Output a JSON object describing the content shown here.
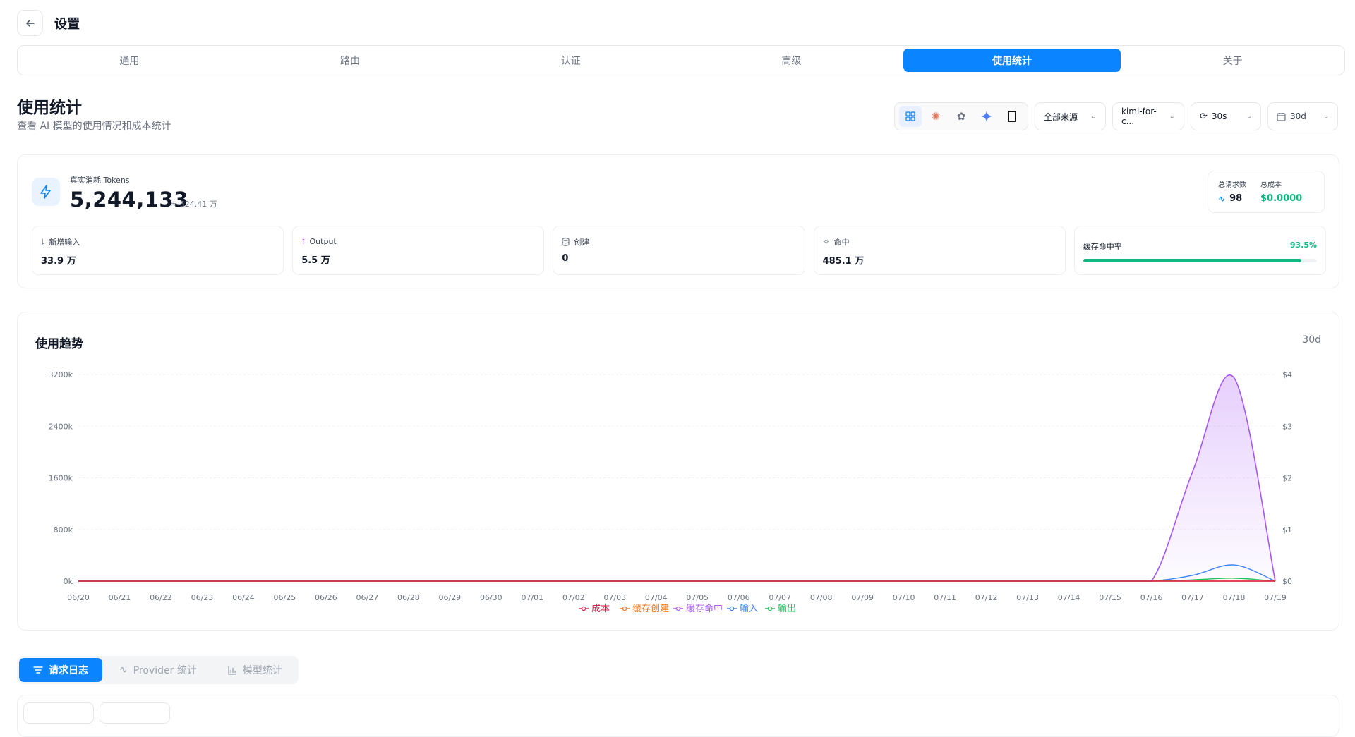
{
  "header": {
    "title": "设置"
  },
  "tabs": [
    {
      "label": "通用",
      "active": false
    },
    {
      "label": "路由",
      "active": false
    },
    {
      "label": "认证",
      "active": false
    },
    {
      "label": "高级",
      "active": false
    },
    {
      "label": "使用统计",
      "active": true
    },
    {
      "label": "关于",
      "active": false
    }
  ],
  "section": {
    "title": "使用统计",
    "subtitle": "查看 AI 模型的使用情况和成本统计"
  },
  "toolbar": {
    "provider_icons": [
      "grid-icon",
      "claude-icon",
      "openai-icon",
      "gemini-icon",
      "kimi-icon"
    ],
    "source_select": "全部来源",
    "model_select": "kimi-for-c...",
    "refresh_select": "30s",
    "range_select": "30d"
  },
  "summary": {
    "tokens_label": "真实消耗 Tokens",
    "tokens_value": "5,244,133",
    "tokens_approx": "≈ 524.41 万",
    "total_requests_label": "总请求数",
    "total_requests_value": "98",
    "total_cost_label": "总成本",
    "total_cost_value": "$0.0000",
    "metrics": [
      {
        "label": "新增输入",
        "value": "33.9 万"
      },
      {
        "label": "Output",
        "value": "5.5 万"
      },
      {
        "label": "创建",
        "value": "0"
      },
      {
        "label": "命中",
        "value": "485.1 万"
      }
    ],
    "cache_hit_label": "缓存命中率",
    "cache_hit_value": "93.5%",
    "cache_hit_fraction": 0.935
  },
  "chart": {
    "title": "使用趋势",
    "range": "30d"
  },
  "chart_data": {
    "type": "area",
    "title": "使用趋势",
    "categories": [
      "06/20",
      "06/21",
      "06/22",
      "06/23",
      "06/24",
      "06/25",
      "06/26",
      "06/27",
      "06/28",
      "06/29",
      "06/30",
      "07/01",
      "07/02",
      "07/03",
      "07/04",
      "07/05",
      "07/06",
      "07/07",
      "07/08",
      "07/09",
      "07/10",
      "07/11",
      "07/12",
      "07/13",
      "07/14",
      "07/15",
      "07/16",
      "07/17",
      "07/18",
      "07/19"
    ],
    "y_left_ticks": [
      "0k",
      "800k",
      "1600k",
      "2400k",
      "3200k"
    ],
    "y_left_range": [
      0,
      3200000
    ],
    "y_right_ticks": [
      "$0",
      "$1",
      "$2",
      "$3",
      "$4"
    ],
    "y_right_range": [
      0,
      4
    ],
    "legend_position": "bottom",
    "grid": true,
    "series": [
      {
        "name": "成本",
        "color": "#e11d48",
        "axis": "right",
        "values": [
          0,
          0,
          0,
          0,
          0,
          0,
          0,
          0,
          0,
          0,
          0,
          0,
          0,
          0,
          0,
          0,
          0,
          0,
          0,
          0,
          0,
          0,
          0,
          0,
          0,
          0,
          0,
          0,
          0,
          0
        ]
      },
      {
        "name": "缓存创建",
        "color": "#f97316",
        "axis": "left",
        "values": [
          0,
          0,
          0,
          0,
          0,
          0,
          0,
          0,
          0,
          0,
          0,
          0,
          0,
          0,
          0,
          0,
          0,
          0,
          0,
          0,
          0,
          0,
          0,
          0,
          0,
          0,
          0,
          0,
          0,
          0
        ]
      },
      {
        "name": "缓存命中",
        "color": "#a855f7",
        "axis": "left",
        "fill": true,
        "values": [
          0,
          0,
          0,
          0,
          0,
          0,
          0,
          0,
          0,
          0,
          0,
          0,
          0,
          0,
          0,
          0,
          0,
          0,
          0,
          0,
          0,
          0,
          0,
          0,
          0,
          0,
          0,
          1700000,
          3150000,
          0
        ]
      },
      {
        "name": "输入",
        "color": "#3b82f6",
        "axis": "left",
        "values": [
          0,
          0,
          0,
          0,
          0,
          0,
          0,
          0,
          0,
          0,
          0,
          0,
          0,
          0,
          0,
          0,
          0,
          0,
          0,
          0,
          0,
          0,
          0,
          0,
          0,
          0,
          0,
          90000,
          250000,
          0
        ]
      },
      {
        "name": "输出",
        "color": "#22c55e",
        "axis": "left",
        "values": [
          0,
          0,
          0,
          0,
          0,
          0,
          0,
          0,
          0,
          0,
          0,
          0,
          0,
          0,
          0,
          0,
          0,
          0,
          0,
          0,
          0,
          0,
          0,
          0,
          0,
          0,
          0,
          20000,
          45000,
          0
        ]
      }
    ]
  },
  "bottom_tabs": [
    {
      "label": "请求日志",
      "active": true
    },
    {
      "label": "Provider 统计",
      "active": false
    },
    {
      "label": "模型统计",
      "active": false
    }
  ]
}
